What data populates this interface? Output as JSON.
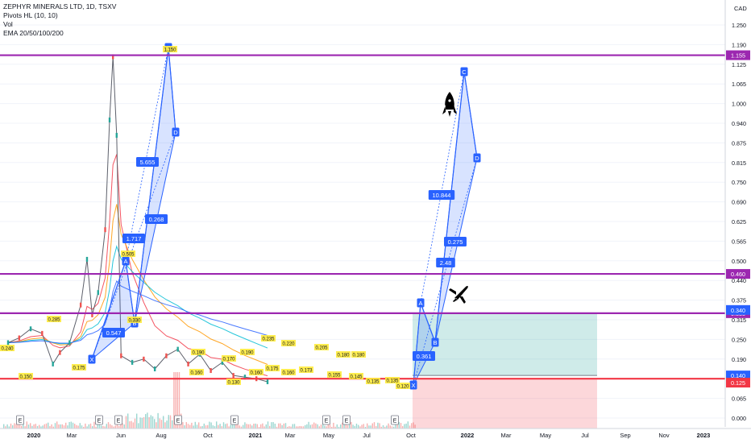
{
  "legend": {
    "symbol": "ZEPHYR MINERALS LTD, 1D, TSXV",
    "pivots": "Pivots HL (10, 10)",
    "vol": "Vol",
    "ema": "EMA 20/50/100/200"
  },
  "currency": "CAD",
  "chart_data": {
    "type": "line",
    "title": "ZEPHYR MINERALS LTD, 1D, TSXV",
    "y_scale": "log",
    "ylim": [
      0.0,
      1.4
    ],
    "y_ticks": [
      "1.250",
      "1.190",
      "1.125",
      "1.065",
      "1.000",
      "0.940",
      "0.875",
      "0.815",
      "0.750",
      "0.690",
      "0.625",
      "0.565",
      "0.500",
      "0.440",
      "0.375",
      "0.315",
      "0.250",
      "0.190",
      "0.130",
      "0.065",
      "0.000"
    ],
    "x_ticks": [
      "2020",
      "Mar",
      "Jun",
      "Aug",
      "Oct",
      "2021",
      "Mar",
      "May",
      "Jul",
      "Oct",
      "2022",
      "Mar",
      "May",
      "Jul",
      "Sep",
      "Nov",
      "2023"
    ],
    "price_series": {
      "name": "Close",
      "x": [
        "2019-11-01",
        "2019-12-01",
        "2020-01-01",
        "2020-02-01",
        "2020-03-01",
        "2020-03-20",
        "2020-04-15",
        "2020-05-15",
        "2020-06-01",
        "2020-06-15",
        "2020-07-01",
        "2020-07-20",
        "2020-08-01",
        "2020-08-10",
        "2020-08-20",
        "2020-09-01",
        "2020-10-01",
        "2020-11-01",
        "2020-12-01",
        "2021-01-01",
        "2021-02-01",
        "2021-03-01",
        "2021-04-01",
        "2021-05-01",
        "2021-06-01",
        "2021-07-01",
        "2021-08-01",
        "2021-09-01",
        "2021-10-01"
      ],
      "y": [
        0.24,
        0.255,
        0.285,
        0.27,
        0.175,
        0.21,
        0.24,
        0.36,
        0.505,
        0.33,
        0.4,
        0.6,
        0.95,
        1.15,
        0.9,
        0.2,
        0.18,
        0.19,
        0.16,
        0.2,
        0.22,
        0.175,
        0.205,
        0.155,
        0.18,
        0.14,
        0.135,
        0.13,
        0.12
      ]
    },
    "price_labels": [
      "0.285",
      "0.240",
      "0.150",
      "0.175",
      "0.505",
      "0.330",
      "1.150",
      "0.190",
      "0.160",
      "0.170",
      "0.130",
      "0.190",
      "0.160",
      "0.175",
      "0.235",
      "0.220",
      "0.160",
      "0.173",
      "0.205",
      "0.155",
      "0.180",
      "0.180",
      "0.145",
      "0.135",
      "0.135",
      "0.120"
    ],
    "horizontal_lines": [
      {
        "value": 1.155,
        "label": "1.155",
        "color": "#9c27b0"
      },
      {
        "value": 0.46,
        "label": "0.460",
        "color": "#9c27b0"
      },
      {
        "value": 0.335,
        "label": "0.335",
        "color": "#9c27b0"
      },
      {
        "value": 0.13,
        "label": "0.130",
        "color": "#f23645"
      }
    ],
    "right_axis_badges": [
      {
        "label": "0.340",
        "color": "#2962ff"
      },
      {
        "label": "0.140",
        "color": "#2962ff"
      },
      {
        "label": "0.125",
        "color": "#f23645"
      }
    ],
    "harmonic_pattern_1": {
      "points": [
        "X",
        "A",
        "B",
        "C",
        "D"
      ],
      "ratios": [
        "0.547",
        "1.717",
        "0.268",
        "5.655"
      ]
    },
    "harmonic_pattern_2": {
      "points": [
        "X",
        "A",
        "B",
        "C",
        "D"
      ],
      "ratios": [
        "0.361",
        "2.48",
        "0.275",
        "10.844"
      ]
    },
    "position": {
      "entry": 0.14,
      "target": 0.335,
      "stop": 0.13
    },
    "earnings_markers": [
      "E",
      "E",
      "E",
      "E",
      "E",
      "E",
      "E",
      "E"
    ],
    "icons": [
      "rocket-icon",
      "airplane-icon"
    ]
  }
}
